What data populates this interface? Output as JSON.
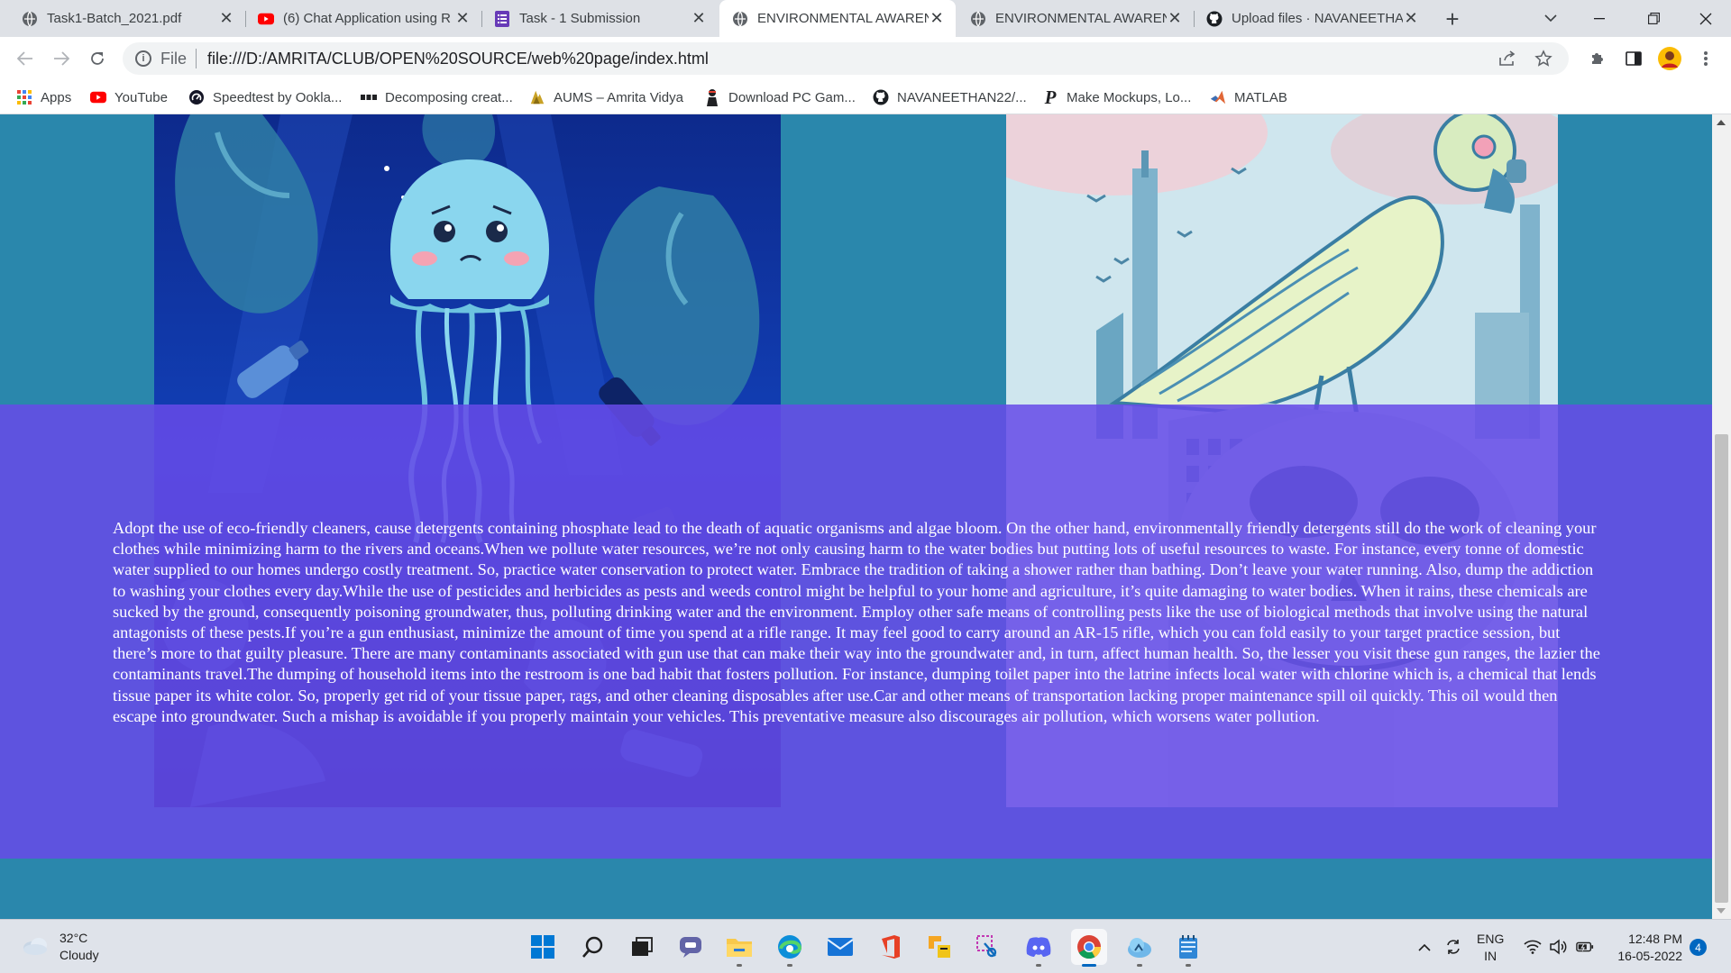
{
  "browser": {
    "tabs": [
      {
        "title": "Task1-Batch_2021.pdf",
        "icon": "globe-icon"
      },
      {
        "title": "(6) Chat Application using R",
        "icon": "youtube-icon"
      },
      {
        "title": "Task - 1 Submission",
        "icon": "forms-icon"
      },
      {
        "title": "ENVIRONMENTAL AWAREN",
        "icon": "globe-icon",
        "active": true
      },
      {
        "title": "ENVIRONMENTAL AWAREN",
        "icon": "globe-icon"
      },
      {
        "title": "Upload files · NAVANEETHA",
        "icon": "github-icon"
      }
    ],
    "address": {
      "scheme": "File",
      "url": "file:///D:/AMRITA/CLUB/OPEN%20SOURCE/web%20page/index.html"
    },
    "bookmarks": [
      {
        "label": "Apps",
        "icon": "apps-grid-icon"
      },
      {
        "label": "YouTube",
        "icon": "youtube-icon"
      },
      {
        "label": "Speedtest by Ookla...",
        "icon": "speedtest-icon"
      },
      {
        "label": "Decomposing creat...",
        "icon": "dots-icon"
      },
      {
        "label": "AUMS – Amrita Vidya",
        "icon": "aums-icon"
      },
      {
        "label": "Download PC Gam...",
        "icon": "game-icon"
      },
      {
        "label": "NAVANEETHAN22/...",
        "icon": "github-icon"
      },
      {
        "label": "Make Mockups, Lo...",
        "icon": "placeit-icon"
      },
      {
        "label": "MATLAB",
        "icon": "matlab-icon"
      }
    ]
  },
  "page": {
    "article_text": "Adopt the use of eco-friendly cleaners, cause detergents containing phosphate lead to the death of aquatic organisms and algae bloom. On the other hand, environmentally friendly detergents still do the work of cleaning your clothes while minimizing harm to the rivers and oceans.When we pollute water resources, we’re not only causing harm to the water bodies but putting lots of useful resources to waste. For instance, every tonne of domestic water supplied to our homes undergo costly treatment. So, practice water conservation to protect water. Embrace the tradition of taking a shower rather than bathing. Don’t leave your water running. Also, dump the addiction to washing your clothes every day.While the use of pesticides and herbicides as pests and weeds control might be helpful to your home and agriculture, it’s quite damaging to water bodies. When it rains, these chemicals are sucked by the ground, consequently poisoning groundwater, thus, polluting drinking water and the environment. Employ other safe means of controlling pests like the use of biological methods that involve using the natural antagonists of these pests.If you’re a gun enthusiast, minimize the amount of time you spend at a rifle range. It may feel good to carry around an AR-15 rifle, which you can fold easily to your target practice session, but there’s more to that guilty pleasure. There are many contaminants associated with gun use that can make their way into the groundwater and, in turn, affect human health. So, the lesser you visit these gun ranges, the lazier the contaminants travel.The dumping of household items into the restroom is one bad habit that fosters pollution. For instance, dumping toilet paper into the latrine infects local water with chlorine which is, a chemical that lends tissue paper its white color. So, properly get rid of your tissue paper, rags, and other cleaning disposables after use.Car and other means of transportation lacking proper maintenance spill oil quickly. This oil would then escape into groundwater. Such a mishap is avoidable if you properly maintain your vehicles. This preventative measure also discourages air pollution, which worsens water pollution.",
    "colors": {
      "page_background": "#2a87ac",
      "section_overlay": "#664ae8",
      "text": "#ffffff"
    }
  },
  "taskbar": {
    "weather": {
      "temp": "32°C",
      "condition": "Cloudy"
    },
    "apps": [
      "windows-start-icon",
      "search-icon",
      "task-view-icon",
      "teams-chat-icon",
      "file-explorer-icon",
      "edge-icon",
      "mail-icon",
      "office-icon",
      "jetbrains-toolbox-icon",
      "snipping-tool-icon",
      "discord-icon",
      "chrome-icon",
      "cloud-app-icon",
      "notepad-icon"
    ],
    "language": {
      "line1": "ENG",
      "line2": "IN"
    },
    "clock": {
      "time": "12:48 PM",
      "date": "16-05-2022"
    },
    "notification_count": "4"
  }
}
